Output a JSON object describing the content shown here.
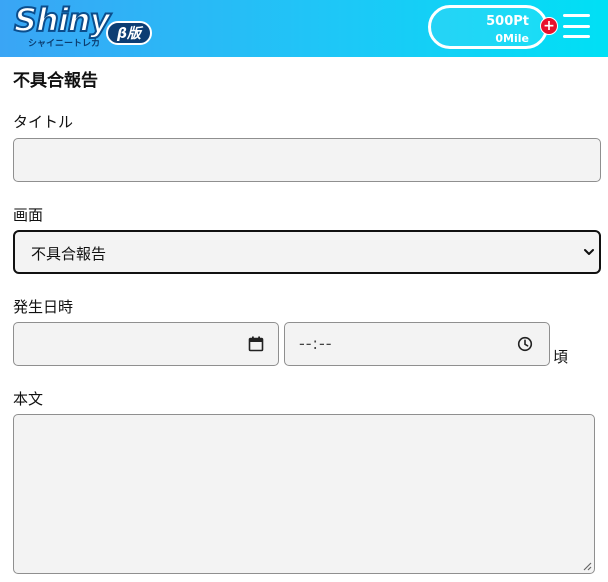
{
  "header": {
    "logo_word": "Shiny",
    "logo_sub": "シャイニートレカ",
    "logo_badge": "β版",
    "points": "500Pt",
    "miles": "0Mile",
    "plus_label": "+"
  },
  "form": {
    "title": "不具合報告",
    "title_label": "タイトル",
    "title_value": "",
    "screen_label": "画面",
    "screen_selected": "不具合報告",
    "date_label": "発生日時",
    "date_value": "",
    "time_placeholder": "--:--",
    "time_suffix": "頃",
    "body_label": "本文",
    "body_value": ""
  },
  "colors": {
    "header_start": "#3aa5f5",
    "header_end": "#00e0f5",
    "badge": "#0d3d73",
    "plus": "#e8112d",
    "field_bg": "#f3f3f3"
  },
  "icons": [
    "menu-icon",
    "plus-icon",
    "calendar-icon",
    "clock-icon",
    "chevron-down-icon"
  ]
}
